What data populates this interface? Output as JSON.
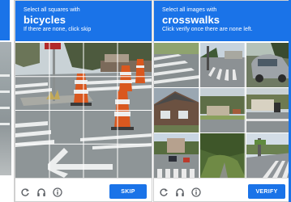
{
  "left_captcha": {
    "instruction": "Select all squares with",
    "target": "bicycles",
    "hint": "If there are none, click skip",
    "action_label": "SKIP"
  },
  "right_captcha": {
    "instruction": "Select all images with",
    "target": "crosswalks",
    "hint": "Click verify once there are none left.",
    "action_label": "VERIFY"
  },
  "footer_icons": [
    "reload-icon",
    "audio-icon",
    "info-icon"
  ],
  "colors": {
    "accent": "#1a73e8"
  }
}
